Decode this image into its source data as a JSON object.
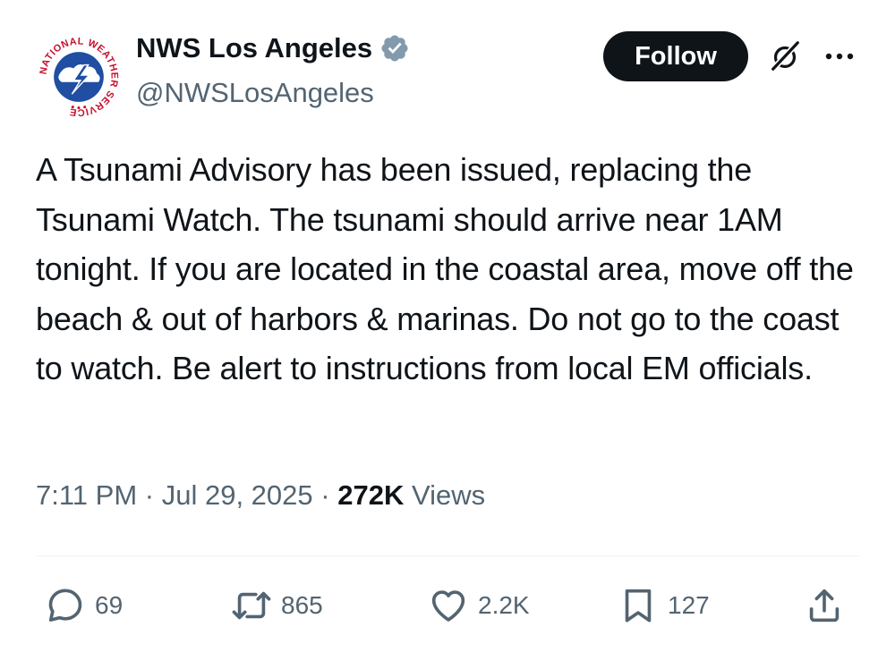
{
  "author": {
    "display_name": "NWS Los Angeles",
    "handle": "@NWSLosAngeles",
    "avatar_icon": "nws-logo-icon",
    "verified_icon": "verified-badge-icon",
    "logo_text": "NATIONAL WEATHER SERVICE"
  },
  "header": {
    "follow_label": "Follow",
    "grok_icon": "grok-icon",
    "more_icon": "more-dots-icon"
  },
  "tweet": {
    "text": "A Tsunami Advisory has been issued, replacing the Tsunami Watch. The tsunami should arrive near 1AM tonight. If you are located in the coastal area, move off the beach & out of harbors & marinas. Do not go to the coast to watch. Be alert to instructions from local EM officials.",
    "time": "7:11 PM",
    "separator": "·",
    "date": "Jul 29, 2025",
    "views_count": "272K",
    "views_label": "Views"
  },
  "actions": {
    "reply_count": "69",
    "repost_count": "865",
    "like_count": "2.2K",
    "bookmark_count": "127",
    "reply_icon": "reply-icon",
    "repost_icon": "repost-icon",
    "like_icon": "heart-icon",
    "bookmark_icon": "bookmark-icon",
    "share_icon": "share-icon"
  },
  "colors": {
    "text_primary": "#0f1419",
    "text_secondary": "#536471",
    "verified": "#829aab",
    "follow_bg": "#0f1419",
    "divider": "#eff3f4",
    "logo_red": "#c8102e",
    "logo_blue": "#1f4ea3"
  }
}
